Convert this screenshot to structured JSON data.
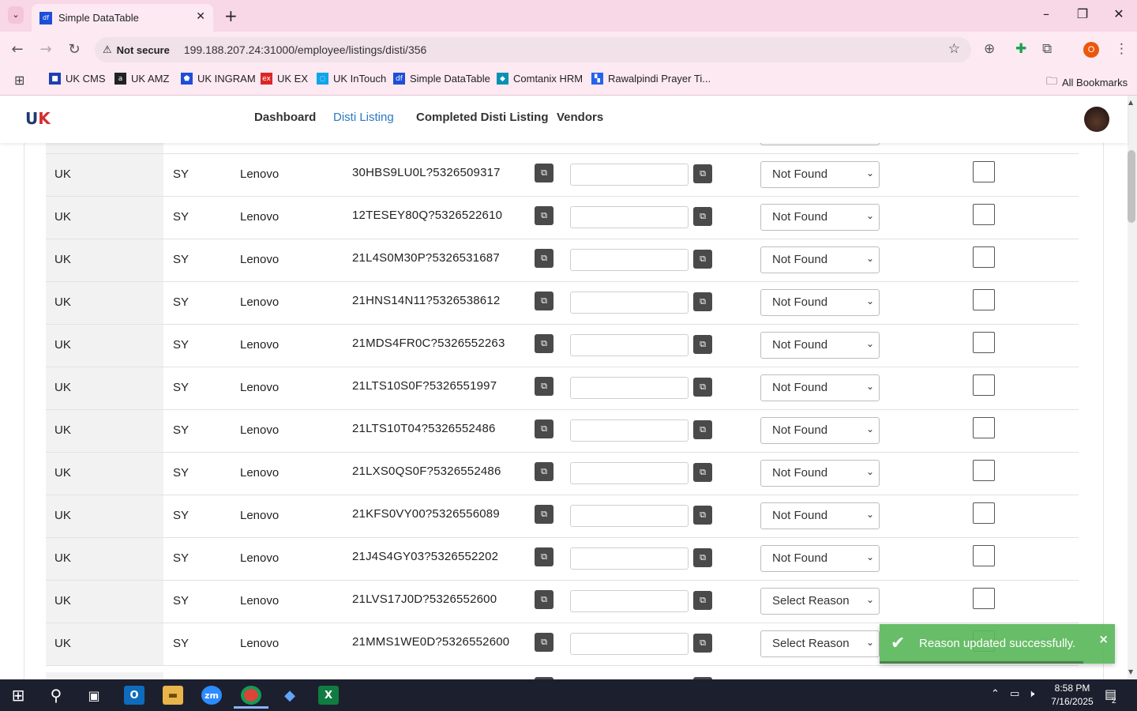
{
  "browser": {
    "tab_title": "Simple DataTable",
    "tab_favicon": "df",
    "not_secure_label": "Not secure",
    "url": "199.188.207.24:31000/employee/listings/disti/356",
    "profile_initial": "O"
  },
  "bookmarks": [
    {
      "label": "UK CMS",
      "icon": "uk-cms-icon",
      "color": "#1e40af",
      "glyph": "■"
    },
    {
      "label": "UK AMZ",
      "icon": "amazon-icon",
      "color": "#222222",
      "glyph": "a"
    },
    {
      "label": "UK INGRAM",
      "icon": "ingram-icon",
      "color": "#1d4ed8",
      "glyph": "⬟"
    },
    {
      "label": "UK EX",
      "icon": "ex-icon",
      "color": "#dc2626",
      "glyph": "ex"
    },
    {
      "label": "UK InTouch",
      "icon": "intouch-icon",
      "color": "#0ea5e9",
      "glyph": "◌"
    },
    {
      "label": "Simple DataTable",
      "icon": "datatable-icon",
      "color": "#1d4ed8",
      "glyph": "df"
    },
    {
      "label": "Comtanix HRM",
      "icon": "hrm-icon",
      "color": "#0891b2",
      "glyph": "◆"
    },
    {
      "label": "Rawalpindi Prayer Ti...",
      "icon": "prayer-icon",
      "color": "#2563eb",
      "glyph": "▚"
    }
  ],
  "all_bookmarks_label": "All Bookmarks",
  "app_nav": {
    "logo_uk": "U",
    "logo_k": "K",
    "links": [
      "Dashboard",
      "Disti Listing",
      "Completed Disti Listing",
      "Vendors"
    ],
    "active": "Disti Listing"
  },
  "rows": [
    {
      "region": "UK",
      "code": "SY",
      "brand": "Lenovo",
      "part": "30HBS9LU0L?5326509317",
      "reason": "Not Found"
    },
    {
      "region": "UK",
      "code": "SY",
      "brand": "Lenovo",
      "part": "12TESEY80Q?5326522610",
      "reason": "Not Found"
    },
    {
      "region": "UK",
      "code": "SY",
      "brand": "Lenovo",
      "part": "21L4S0M30P?5326531687",
      "reason": "Not Found"
    },
    {
      "region": "UK",
      "code": "SY",
      "brand": "Lenovo",
      "part": "21HNS14N11?5326538612",
      "reason": "Not Found"
    },
    {
      "region": "UK",
      "code": "SY",
      "brand": "Lenovo",
      "part": "21MDS4FR0C?5326552263",
      "reason": "Not Found"
    },
    {
      "region": "UK",
      "code": "SY",
      "brand": "Lenovo",
      "part": "21LTS10S0F?5326551997",
      "reason": "Not Found"
    },
    {
      "region": "UK",
      "code": "SY",
      "brand": "Lenovo",
      "part": "21LTS10T04?5326552486",
      "reason": "Not Found"
    },
    {
      "region": "UK",
      "code": "SY",
      "brand": "Lenovo",
      "part": "21LXS0QS0F?5326552486",
      "reason": "Not Found"
    },
    {
      "region": "UK",
      "code": "SY",
      "brand": "Lenovo",
      "part": "21KFS0VY00?5326556089",
      "reason": "Not Found"
    },
    {
      "region": "UK",
      "code": "SY",
      "brand": "Lenovo",
      "part": "21J4S4GY03?5326552202",
      "reason": "Not Found"
    },
    {
      "region": "UK",
      "code": "SY",
      "brand": "Lenovo",
      "part": "21LVS17J0D?5326552600",
      "reason": "Select Reason"
    },
    {
      "region": "UK",
      "code": "SY",
      "brand": "Lenovo",
      "part": "21MMS1WE0D?5326552600",
      "reason": "Select Reason"
    }
  ],
  "toast": {
    "message": "Reason updated successfully.",
    "close": "×",
    "color": "#5cb85c"
  },
  "taskbar": {
    "time": "8:58 PM",
    "date": "7/16/2025",
    "notification_count": "2",
    "zoom_label": "zm",
    "chrome_badge": "0"
  }
}
